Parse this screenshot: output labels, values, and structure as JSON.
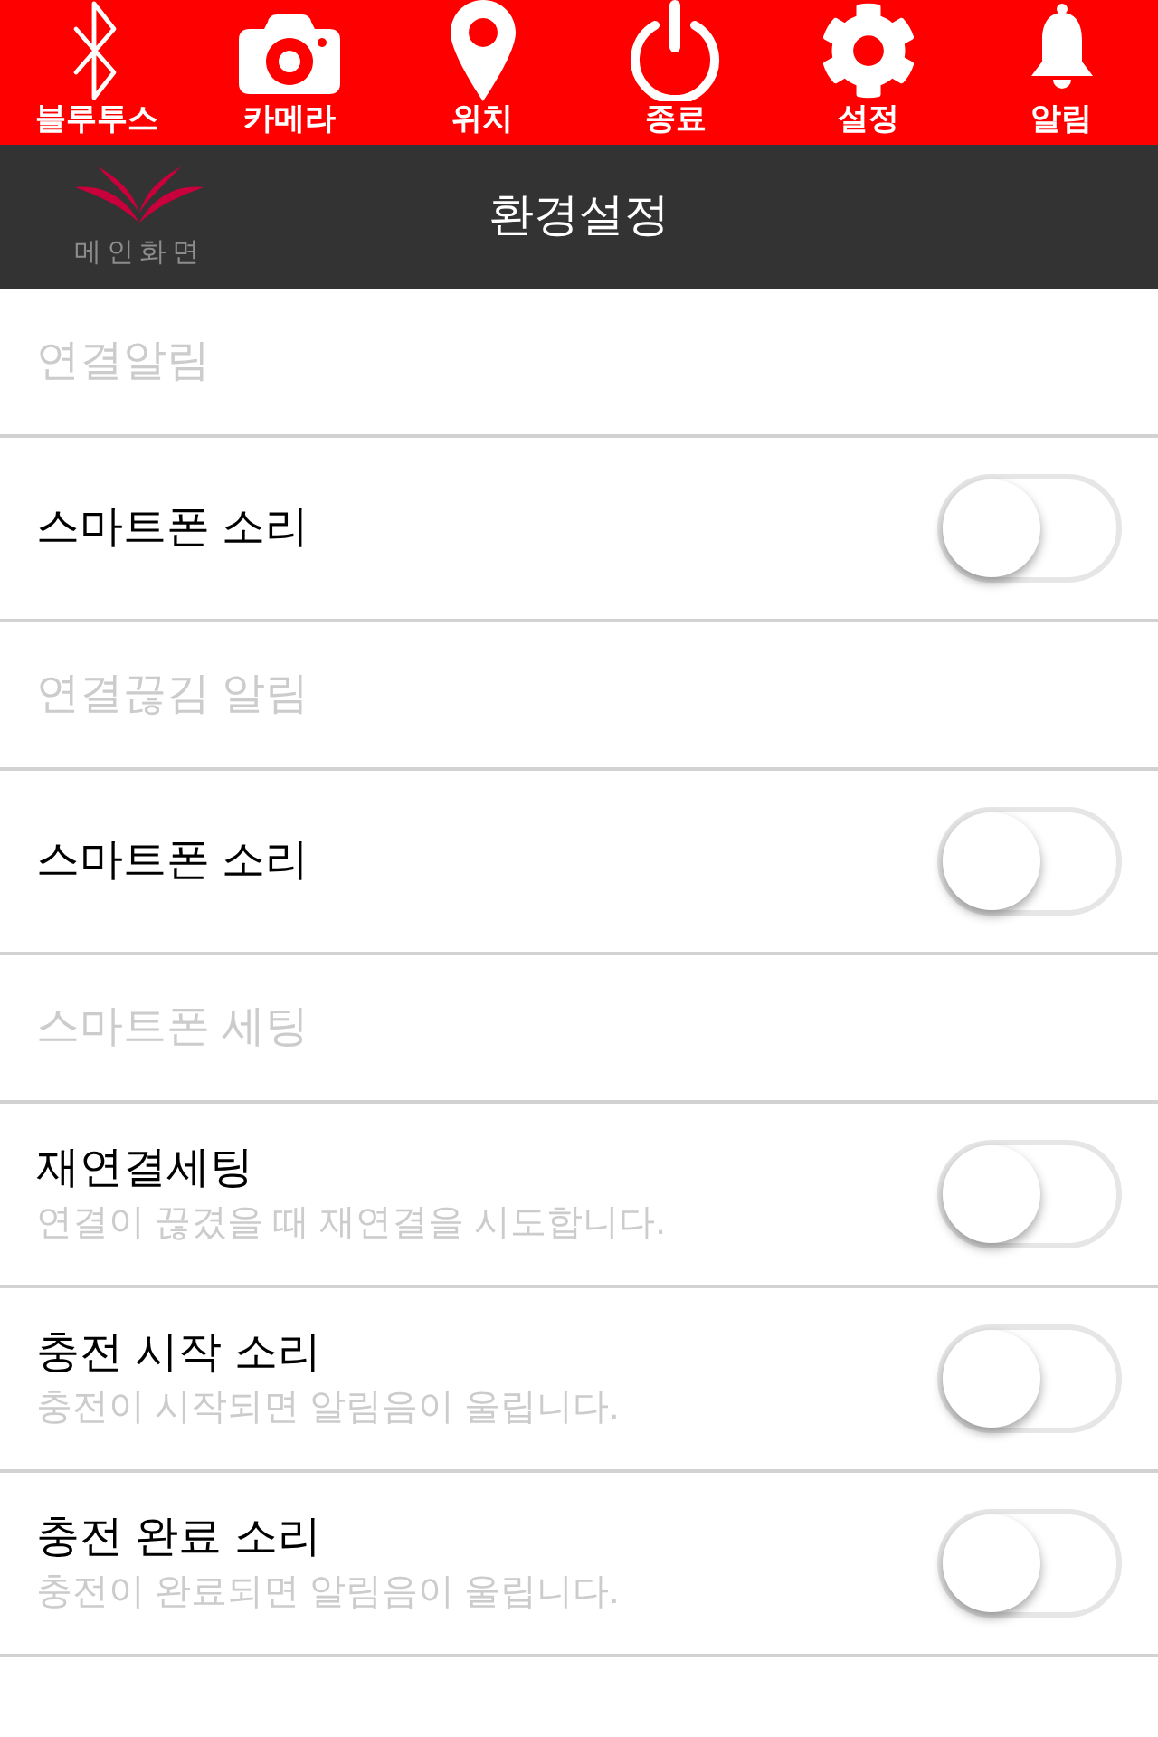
{
  "toolbar": {
    "items": [
      {
        "label": "블루투스"
      },
      {
        "label": "카메라"
      },
      {
        "label": "위치"
      },
      {
        "label": "종료"
      },
      {
        "label": "설정"
      },
      {
        "label": "알림"
      }
    ]
  },
  "header": {
    "logo_caption": "메인화면",
    "title": "환경설정"
  },
  "settings": [
    {
      "kind": "section",
      "label": "연결알림"
    },
    {
      "kind": "toggle",
      "label": "스마트폰 소리",
      "on": false
    },
    {
      "kind": "section",
      "label": "연결끊김 알림"
    },
    {
      "kind": "toggle",
      "label": "스마트폰 소리",
      "on": false
    },
    {
      "kind": "section",
      "label": "스마트폰 세팅"
    },
    {
      "kind": "toggle",
      "label": "재연결세팅",
      "description": "연결이 끊겼을 때 재연결을 시도합니다.",
      "on": false
    },
    {
      "kind": "toggle",
      "label": "충전 시작 소리",
      "description": "충전이 시작되면 알림음이 울립니다.",
      "on": false
    },
    {
      "kind": "toggle",
      "label": "충전 완료 소리",
      "description": "충전이 완료되면 알림음이 울립니다.",
      "on": false
    }
  ]
}
